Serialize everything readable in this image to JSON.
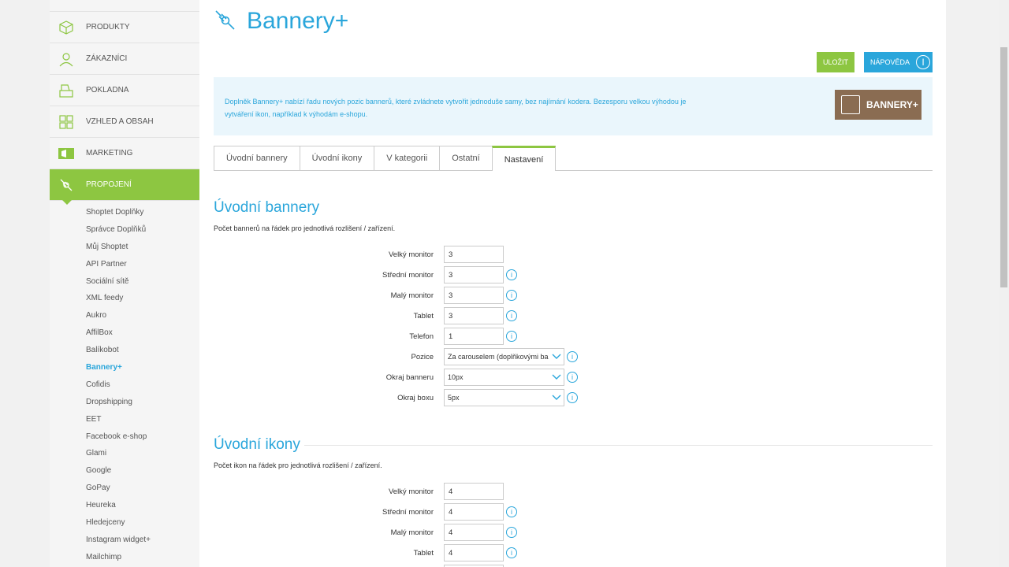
{
  "nav": {
    "items": [
      {
        "label": "PRODUKTY",
        "icon": "box-icon"
      },
      {
        "label": "ZÁKAZNÍCI",
        "icon": "user-icon"
      },
      {
        "label": "POKLADNA",
        "icon": "cash-register-icon"
      },
      {
        "label": "VZHLED A OBSAH",
        "icon": "layout-icon"
      },
      {
        "label": "MARKETING",
        "icon": "megaphone-icon"
      },
      {
        "label": "PROPOJENÍ",
        "icon": "plug-icon"
      }
    ],
    "subitems": [
      "Shoptet Doplňky",
      "Správce Doplňků",
      "Můj Shoptet",
      "API Partner",
      "Sociální sítě",
      "XML feedy",
      "Aukro",
      "AffilBox",
      "Balíkobot",
      "Bannery+",
      "Cofidis",
      "Dropshipping",
      "EET",
      "Facebook e-shop",
      "Glami",
      "Google",
      "GoPay",
      "Heureka",
      "Hledejceny",
      "Instagram widget+",
      "Mailchimp"
    ]
  },
  "page": {
    "title": "Bannery+",
    "save_label": "ULOŽIT",
    "help_label": "NÁPOVĚDA",
    "info_text": "Doplněk Bannery+ nabízí řadu nových pozic bannerů, které zvládnete vytvořit jednoduše samy, bez najímání kodera. Bezesporu velkou výhodou je vytváření ikon, například k výhodám e-shopu.",
    "logo_text": "BANNERY+"
  },
  "tabs": [
    "Úvodní bannery",
    "Úvodní ikony",
    "V kategorii",
    "Ostatní",
    "Nastavení"
  ],
  "section1": {
    "title": "Úvodní bannery",
    "desc": "Počet bannerů na řádek pro jednotlivá rozlišení / zařízení.",
    "rows": [
      {
        "label": "Velký monitor",
        "value": "3"
      },
      {
        "label": "Střední monitor",
        "value": "3"
      },
      {
        "label": "Malý monitor",
        "value": "3"
      },
      {
        "label": "Tablet",
        "value": "3"
      },
      {
        "label": "Telefon",
        "value": "1"
      }
    ],
    "selects": [
      {
        "label": "Pozice",
        "value": "Za carouselem (doplňkovými ba"
      },
      {
        "label": "Okraj banneru",
        "value": "10px"
      },
      {
        "label": "Okraj boxu",
        "value": "5px"
      }
    ]
  },
  "section2": {
    "title": "Úvodní ikony",
    "desc": "Počet ikon na řádek pro jednotlivá rozlišení / zařízení.",
    "rows": [
      {
        "label": "Velký monitor",
        "value": "4"
      },
      {
        "label": "Střední monitor",
        "value": "4"
      },
      {
        "label": "Malý monitor",
        "value": "4"
      },
      {
        "label": "Tablet",
        "value": "4"
      }
    ]
  },
  "colors": {
    "accent_green": "#8dc641",
    "accent_blue": "#2aa6db",
    "logo_brown": "#8a6c52"
  }
}
